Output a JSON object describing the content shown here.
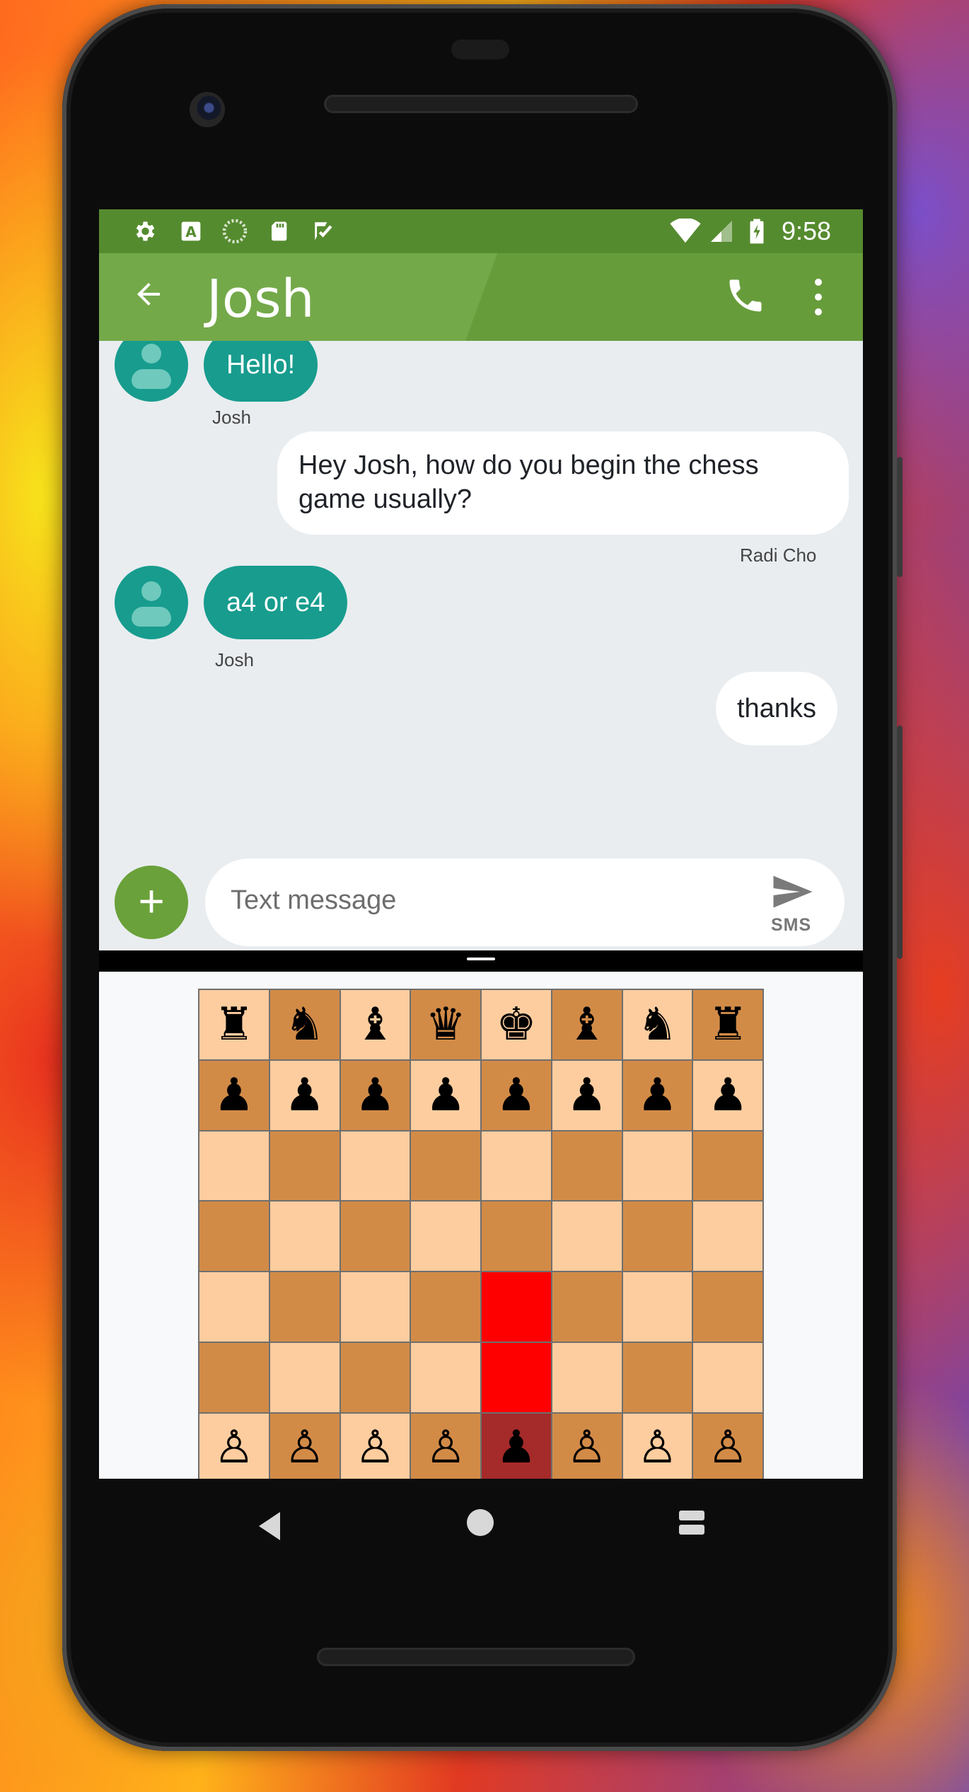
{
  "status_bar": {
    "time": "9:58",
    "left_icons": [
      "gear-icon",
      "font-a-icon",
      "sync-icon",
      "sd-card-icon",
      "checklist-icon"
    ],
    "right_icons": [
      "wifi-icon",
      "signal-icon",
      "battery-charging-icon"
    ],
    "bg_color": "#558b2f"
  },
  "app_bar": {
    "title": "Josh",
    "color": "#74a94a"
  },
  "messages": [
    {
      "from": "Josh",
      "direction": "in",
      "text": "Hello!",
      "sender_label": "Josh"
    },
    {
      "from": "Radi Cho",
      "direction": "out",
      "text": "Hey Josh, how do you begin the chess game usually?",
      "sender_label": "Radi Cho"
    },
    {
      "from": "Josh",
      "direction": "in",
      "text": "a4 or e4",
      "sender_label": "Josh"
    },
    {
      "from": "Radi Cho",
      "direction": "out",
      "text": "thanks"
    }
  ],
  "compose": {
    "placeholder": "Text message",
    "send_type": "SMS"
  },
  "chess": {
    "ranks": [
      [
        "♜",
        "♞",
        "♝",
        "♛",
        "♚",
        "♝",
        "♞",
        "♜"
      ],
      [
        "♟",
        "♟",
        "♟",
        "♟",
        "♟",
        "♟",
        "♟",
        "♟"
      ],
      [
        "",
        "",
        "",
        "",
        "",
        "",
        "",
        ""
      ],
      [
        "",
        "",
        "",
        "",
        "",
        "",
        "",
        ""
      ],
      [
        "",
        "",
        "",
        "",
        "",
        "",
        "",
        ""
      ],
      [
        "",
        "",
        "",
        "",
        "",
        "",
        "",
        ""
      ],
      [
        "♙",
        "♙",
        "♙",
        "♙",
        "♟",
        "♙",
        "♙",
        "♙"
      ],
      [
        "♖",
        "♘",
        "♗",
        "♕",
        "♔",
        "♗",
        "♘",
        "♖"
      ]
    ],
    "highlighted_squares": [
      "e4",
      "e3"
    ],
    "selected_square": "e2",
    "light_color": "#fecd9f",
    "dark_color": "#d28b47",
    "highlight_color": "#ff0000",
    "selected_color": "#a52a2a"
  },
  "nav_bar": [
    "back-icon",
    "home-icon",
    "recents-icon"
  ]
}
